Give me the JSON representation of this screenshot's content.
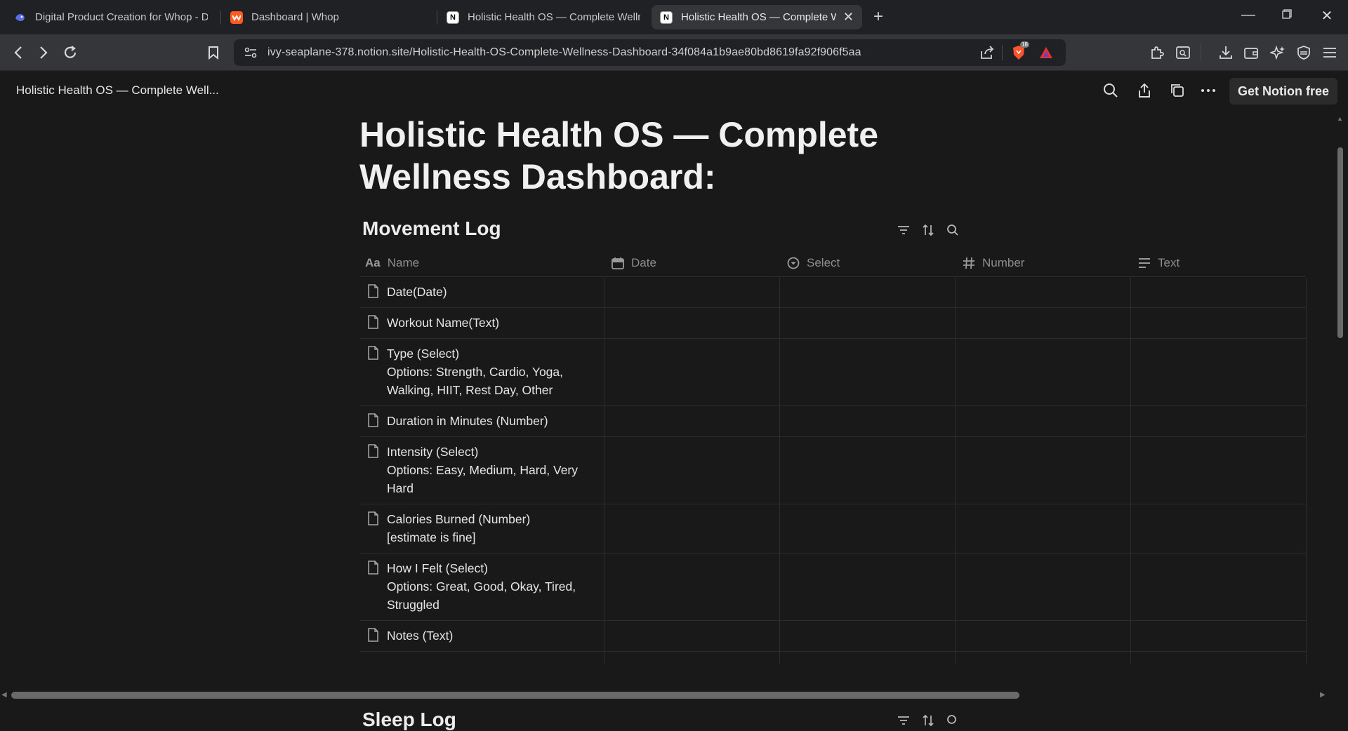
{
  "browser": {
    "tabs": [
      {
        "title": "Digital Product Creation for Whop - D",
        "icon": "claude-icon",
        "active": false
      },
      {
        "title": "Dashboard | Whop",
        "icon": "whop-icon",
        "active": false
      },
      {
        "title": "Holistic Health OS — Complete Welln",
        "icon": "notion-icon",
        "active": false
      },
      {
        "title": "Holistic Health OS — Complete W",
        "icon": "notion-icon",
        "active": true
      }
    ],
    "new_tab": "+",
    "url": "ivy-seaplane-378.notion.site/Holistic-Health-OS-Complete-Wellness-Dashboard-34f084a1b9ae80bd8619fa92f906f5aa",
    "brave_badge": "18"
  },
  "notion_header": {
    "breadcrumb": "Holistic Health OS — Complete Well...",
    "get_notion": "Get Notion free"
  },
  "page": {
    "title": "Holistic Health OS — Complete Wellness Dashboard:"
  },
  "movement_log": {
    "title": "Movement Log",
    "columns": [
      {
        "label": "Name",
        "icon": "text-aa-icon"
      },
      {
        "label": "Date",
        "icon": "calendar-icon"
      },
      {
        "label": "Select",
        "icon": "select-icon"
      },
      {
        "label": "Number",
        "icon": "hash-icon"
      },
      {
        "label": "Text",
        "icon": "lines-icon"
      }
    ],
    "rows": [
      {
        "lines": [
          "Date(Date)"
        ]
      },
      {
        "lines": [
          "Workout Name(Text)"
        ]
      },
      {
        "lines": [
          "Type (Select)",
          "Options: Strength, Cardio, Yoga,",
          "Walking, HIIT, Rest Day, Other"
        ]
      },
      {
        "lines": [
          "Duration in Minutes (Number)"
        ]
      },
      {
        "lines": [
          "Intensity (Select)",
          "Options: Easy, Medium, Hard, Very",
          "Hard"
        ]
      },
      {
        "lines": [
          "Calories Burned (Number)",
          "[estimate is fine]"
        ]
      },
      {
        "lines": [
          "How I Felt (Select)",
          "Options: Great, Good, Okay, Tired,",
          "Struggled"
        ]
      },
      {
        "lines": [
          "Notes (Text)"
        ]
      }
    ]
  },
  "next_section": {
    "title": "Sleep Log"
  }
}
